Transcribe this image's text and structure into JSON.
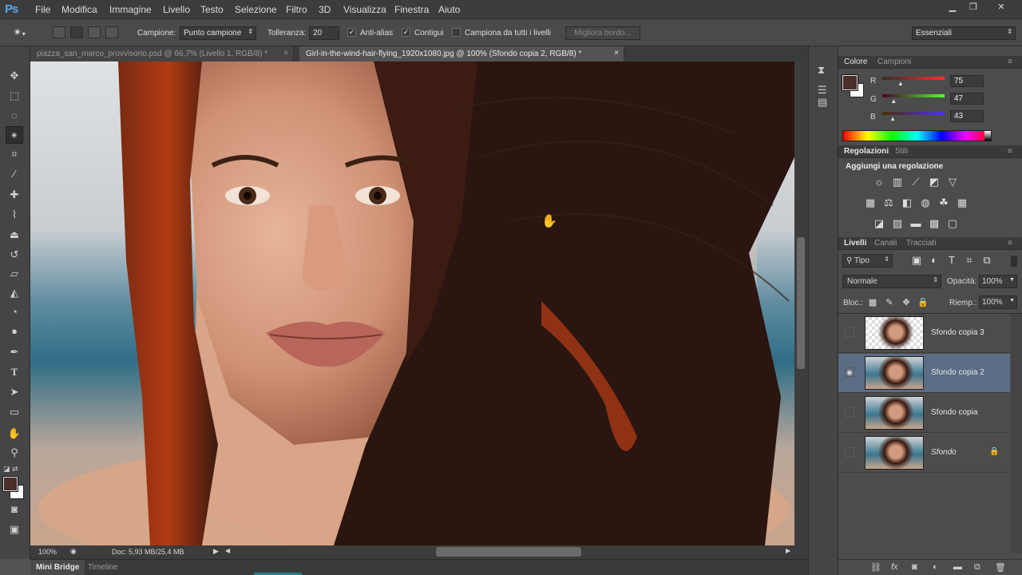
{
  "app": {
    "logo": "Ps"
  },
  "menu": [
    "File",
    "Modifica",
    "Immagine",
    "Livello",
    "Testo",
    "Selezione",
    "Filtro",
    "3D",
    "Visualizza",
    "Finestra",
    "Aiuto"
  ],
  "window_controls": {
    "minimize": "▁",
    "restore": "❐",
    "close": "✕"
  },
  "options": {
    "sample_label": "Campione:",
    "sample_value": "Punto campione",
    "tolerance_label": "Tolleranza:",
    "tolerance_value": "20",
    "antialias_label": "Anti-alias",
    "antialias_checked": true,
    "contiguous_label": "Contigui",
    "contiguous_checked": true,
    "all_layers_label": "Campiona da tutti i livelli",
    "all_layers_checked": false,
    "refine_edge": "Migliora bordo...",
    "workspace": "Essenziali"
  },
  "tabs": [
    {
      "label": "piazza_san_marco_provvisorio.psd @ 66,7% (Livello 1, RGB/8) *",
      "active": false
    },
    {
      "label": "Girl-in-the-wind-hair-flying_1920x1080.jpg @ 100% (Sfondo copia 2, RGB/8) *",
      "active": true
    }
  ],
  "tab_close": "×",
  "status": {
    "zoom": "100%",
    "doc": "Doc: 5,93 MB/25,4 MB"
  },
  "bottom_tabs": [
    "Mini Bridge",
    "Timeline"
  ],
  "color_panel": {
    "tabs": [
      "Colore",
      "Campioni"
    ],
    "channels": [
      {
        "name": "R",
        "value": "75",
        "fraction": 0.294
      },
      {
        "name": "G",
        "value": "47",
        "fraction": 0.184
      },
      {
        "name": "B",
        "value": "43",
        "fraction": 0.169
      }
    ],
    "foreground": "#4b2f2b",
    "background": "#ffffff"
  },
  "adjust_panel": {
    "tabs": [
      "Regolazioni",
      "Stili"
    ],
    "heading": "Aggiungi una regolazione"
  },
  "layers_panel": {
    "tabs": [
      "Livelli",
      "Canali",
      "Tracciati"
    ],
    "filter": "Tipo",
    "blend_mode": "Normale",
    "opacity_label": "Opacità:",
    "opacity": "100%",
    "lock_label": "Bloc.:",
    "fill_label": "Riemp.:",
    "fill": "100%",
    "layers": [
      {
        "name": "Sfondo copia 3",
        "visible": false,
        "active": false,
        "transparent": true
      },
      {
        "name": "Sfondo copia 2",
        "visible": true,
        "active": true,
        "transparent": false
      },
      {
        "name": "Sfondo copia",
        "visible": false,
        "active": false,
        "transparent": false
      },
      {
        "name": "Sfondo",
        "visible": false,
        "active": false,
        "transparent": false,
        "locked": true
      }
    ]
  }
}
